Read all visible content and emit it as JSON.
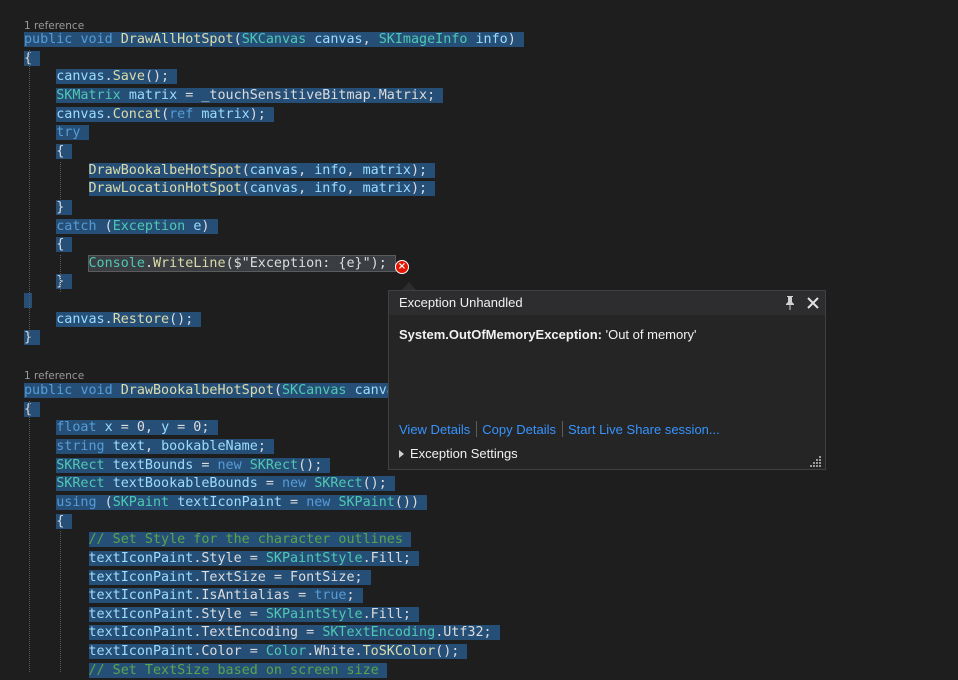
{
  "editor": {
    "method1": {
      "references": "1 reference",
      "lines": [
        [
          [
            "k",
            "public"
          ],
          [
            "p",
            " "
          ],
          [
            "k",
            "void"
          ],
          [
            "p",
            " "
          ],
          [
            "m",
            "DrawAllHotSpot"
          ],
          [
            "p",
            "("
          ],
          [
            "t",
            "SKCanvas"
          ],
          [
            "p",
            " "
          ],
          [
            "v",
            "canvas"
          ],
          [
            "p",
            ", "
          ],
          [
            "t",
            "SKImageInfo"
          ],
          [
            "p",
            " "
          ],
          [
            "v",
            "info"
          ],
          [
            "p",
            ")"
          ]
        ],
        [
          [
            "p",
            "{"
          ]
        ],
        [
          [
            "p",
            "    "
          ],
          [
            "v",
            "canvas"
          ],
          [
            "p",
            "."
          ],
          [
            "m",
            "Save"
          ],
          [
            "p",
            "();"
          ]
        ],
        [
          [
            "p",
            "    "
          ],
          [
            "t",
            "SKMatrix"
          ],
          [
            "p",
            " "
          ],
          [
            "v",
            "matrix"
          ],
          [
            "p",
            " = _touchSensitiveBitmap.Matrix;"
          ]
        ],
        [
          [
            "p",
            "    "
          ],
          [
            "v",
            "canvas"
          ],
          [
            "p",
            "."
          ],
          [
            "m",
            "Concat"
          ],
          [
            "p",
            "("
          ],
          [
            "k",
            "ref"
          ],
          [
            "p",
            " "
          ],
          [
            "v",
            "matrix"
          ],
          [
            "p",
            ");"
          ]
        ],
        [
          [
            "p",
            "    "
          ],
          [
            "k",
            "try"
          ]
        ],
        [
          [
            "p",
            "    {"
          ]
        ],
        [
          [
            "p",
            "        "
          ],
          [
            "m",
            "DrawBookalbeHotSpot"
          ],
          [
            "p",
            "("
          ],
          [
            "v",
            "canvas"
          ],
          [
            "p",
            ", "
          ],
          [
            "v",
            "info"
          ],
          [
            "p",
            ", "
          ],
          [
            "v",
            "matrix"
          ],
          [
            "p",
            ");"
          ]
        ],
        [
          [
            "p",
            "        "
          ],
          [
            "m",
            "DrawLocationHotSpot"
          ],
          [
            "p",
            "("
          ],
          [
            "v",
            "canvas"
          ],
          [
            "p",
            ", "
          ],
          [
            "v",
            "info"
          ],
          [
            "p",
            ", "
          ],
          [
            "v",
            "matrix"
          ],
          [
            "p",
            ");"
          ]
        ],
        [
          [
            "p",
            "    }"
          ]
        ],
        [
          [
            "p",
            "    "
          ],
          [
            "k",
            "catch"
          ],
          [
            "p",
            " ("
          ],
          [
            "t",
            "Exception"
          ],
          [
            "p",
            " "
          ],
          [
            "v",
            "e"
          ],
          [
            "p",
            ")"
          ]
        ],
        [
          [
            "p",
            "    {"
          ]
        ],
        [
          [
            "p",
            "        "
          ],
          [
            "t",
            "Console"
          ],
          [
            "p",
            "."
          ],
          [
            "m",
            "WriteLine"
          ],
          [
            "p",
            "($\"Exception: {e}\");"
          ]
        ],
        [
          [
            "p",
            "    }"
          ]
        ],
        [
          [
            "p",
            ""
          ]
        ],
        [
          [
            "p",
            "    "
          ],
          [
            "v",
            "canvas"
          ],
          [
            "p",
            "."
          ],
          [
            "m",
            "Restore"
          ],
          [
            "p",
            "();"
          ]
        ],
        [
          [
            "p",
            "}"
          ]
        ]
      ]
    },
    "method2": {
      "references": "1 reference",
      "lines": [
        [
          [
            "k",
            "public"
          ],
          [
            "p",
            " "
          ],
          [
            "k",
            "void"
          ],
          [
            "p",
            " "
          ],
          [
            "m",
            "DrawBookalbeHotSpot"
          ],
          [
            "p",
            "("
          ],
          [
            "t",
            "SKCanvas"
          ],
          [
            "p",
            " "
          ],
          [
            "v",
            "canva"
          ]
        ],
        [
          [
            "p",
            "{"
          ]
        ],
        [
          [
            "p",
            "    "
          ],
          [
            "k",
            "float"
          ],
          [
            "p",
            " "
          ],
          [
            "v",
            "x"
          ],
          [
            "p",
            " = 0, "
          ],
          [
            "v",
            "y"
          ],
          [
            "p",
            " = 0;"
          ]
        ],
        [
          [
            "p",
            "    "
          ],
          [
            "k",
            "string"
          ],
          [
            "p",
            " "
          ],
          [
            "v",
            "text"
          ],
          [
            "p",
            ", "
          ],
          [
            "v",
            "bookableName"
          ],
          [
            "p",
            ";"
          ]
        ],
        [
          [
            "p",
            "    "
          ],
          [
            "t",
            "SKRect"
          ],
          [
            "p",
            " "
          ],
          [
            "v",
            "textBounds"
          ],
          [
            "p",
            " = "
          ],
          [
            "k",
            "new"
          ],
          [
            "p",
            " "
          ],
          [
            "t",
            "SKRect"
          ],
          [
            "p",
            "();"
          ]
        ],
        [
          [
            "p",
            "    "
          ],
          [
            "t",
            "SKRect"
          ],
          [
            "p",
            " "
          ],
          [
            "v",
            "textBookableBounds"
          ],
          [
            "p",
            " = "
          ],
          [
            "k",
            "new"
          ],
          [
            "p",
            " "
          ],
          [
            "t",
            "SKRect"
          ],
          [
            "p",
            "();"
          ]
        ],
        [
          [
            "p",
            "    "
          ],
          [
            "k",
            "using"
          ],
          [
            "p",
            " ("
          ],
          [
            "t",
            "SKPaint"
          ],
          [
            "p",
            " "
          ],
          [
            "v",
            "textIconPaint"
          ],
          [
            "p",
            " = "
          ],
          [
            "k",
            "new"
          ],
          [
            "p",
            " "
          ],
          [
            "t",
            "SKPaint"
          ],
          [
            "p",
            "())"
          ]
        ],
        [
          [
            "p",
            "    {"
          ]
        ],
        [
          [
            "p",
            "        "
          ],
          [
            "c",
            "// Set Style for the character outlines"
          ]
        ],
        [
          [
            "p",
            "        "
          ],
          [
            "v",
            "textIconPaint"
          ],
          [
            "p",
            ".Style = "
          ],
          [
            "t",
            "SKPaintStyle"
          ],
          [
            "p",
            ".Fill;"
          ]
        ],
        [
          [
            "p",
            "        "
          ],
          [
            "v",
            "textIconPaint"
          ],
          [
            "p",
            ".TextSize = FontSize;"
          ]
        ],
        [
          [
            "p",
            "        "
          ],
          [
            "v",
            "textIconPaint"
          ],
          [
            "p",
            ".IsAntialias = "
          ],
          [
            "k",
            "true"
          ],
          [
            "p",
            ";"
          ]
        ],
        [
          [
            "p",
            "        "
          ],
          [
            "v",
            "textIconPaint"
          ],
          [
            "p",
            ".Style = "
          ],
          [
            "t",
            "SKPaintStyle"
          ],
          [
            "p",
            ".Fill;"
          ]
        ],
        [
          [
            "p",
            "        "
          ],
          [
            "v",
            "textIconPaint"
          ],
          [
            "p",
            ".TextEncoding = "
          ],
          [
            "t",
            "SKTextEncoding"
          ],
          [
            "p",
            ".Utf32;"
          ]
        ],
        [
          [
            "p",
            "        "
          ],
          [
            "v",
            "textIconPaint"
          ],
          [
            "p",
            ".Color = "
          ],
          [
            "t",
            "Color"
          ],
          [
            "p",
            ".White."
          ],
          [
            "m",
            "ToSKColor"
          ],
          [
            "p",
            "();"
          ]
        ],
        [
          [
            "p",
            "        "
          ],
          [
            "c",
            "// Set TextSize based on screen size"
          ]
        ]
      ]
    }
  },
  "exception_popup": {
    "title": "Exception Unhandled",
    "exception_type": "System.OutOfMemoryException:",
    "exception_message": " 'Out of memory'",
    "links": [
      "View Details",
      "Copy Details",
      "Start Live Share session..."
    ],
    "settings_label": "Exception Settings",
    "icons": {
      "pin": "pin-icon",
      "close": "close-icon",
      "error": "error-glyph-icon",
      "expander": "expander-icon",
      "grip": "resize-grip-icon"
    },
    "colors": {
      "link": "#3794ff",
      "error": "#e51400",
      "selection": "#264f78"
    }
  }
}
